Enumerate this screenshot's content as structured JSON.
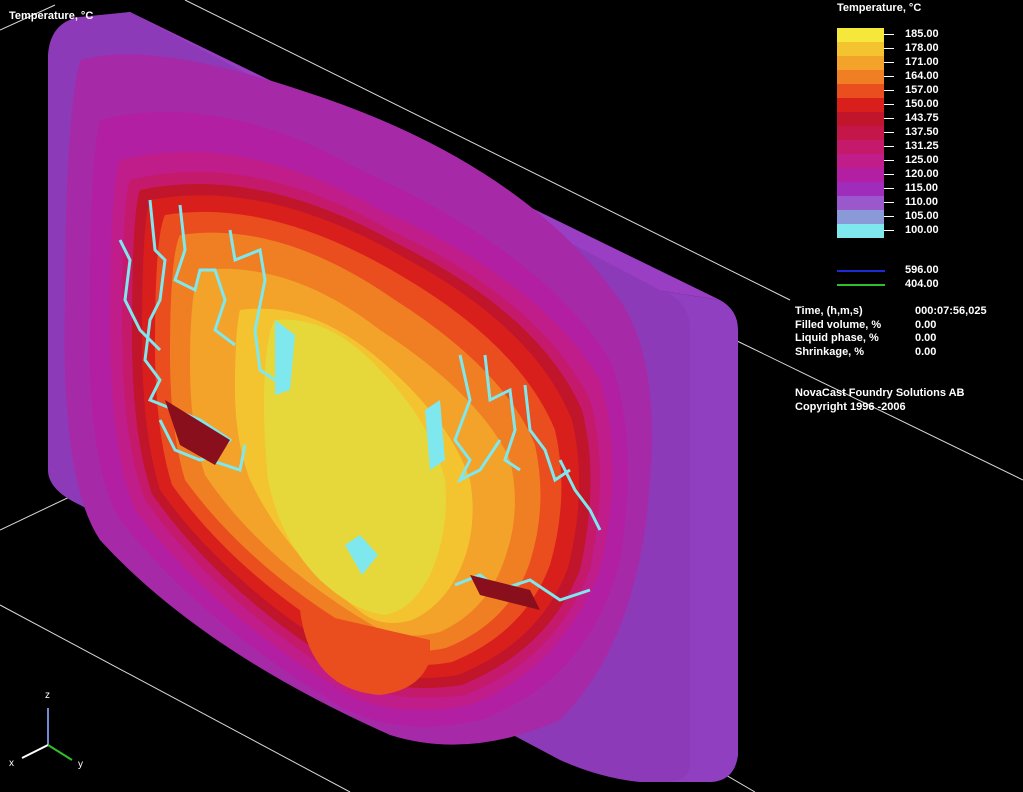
{
  "view": {
    "title": "Temperature, °C"
  },
  "legend": {
    "title": "Temperature, °C",
    "bands": [
      {
        "value": "185.00",
        "color": "#f6e83a"
      },
      {
        "value": "178.00",
        "color": "#f4c430"
      },
      {
        "value": "171.00",
        "color": "#f3a22a"
      },
      {
        "value": "164.00",
        "color": "#f07f24"
      },
      {
        "value": "157.00",
        "color": "#ea4d1e"
      },
      {
        "value": "150.00",
        "color": "#d81f1c"
      },
      {
        "value": "143.75",
        "color": "#c0152a"
      },
      {
        "value": "137.50",
        "color": "#c41648"
      },
      {
        "value": "131.25",
        "color": "#c51a6c"
      },
      {
        "value": "125.00",
        "color": "#c01c8a"
      },
      {
        "value": "120.00",
        "color": "#b21fa2"
      },
      {
        "value": "115.00",
        "color": "#a02cbc"
      },
      {
        "value": "110.00",
        "color": "#9a58cc"
      },
      {
        "value": "105.00",
        "color": "#8a9ad8"
      },
      {
        "value": "100.00",
        "color": "#7ee8ee"
      }
    ],
    "lines": [
      {
        "value": "596.00",
        "color": "#1d2bd6"
      },
      {
        "value": "404.00",
        "color": "#2fbf28"
      }
    ]
  },
  "info": [
    {
      "label": "Time, (h,m,s)",
      "value": "000:07:56,025"
    },
    {
      "label": "Filled volume, %",
      "value": "0.00"
    },
    {
      "label": "Liquid phase, %",
      "value": "0.00"
    },
    {
      "label": "Shrinkage, %",
      "value": "0.00"
    }
  ],
  "credits": {
    "company": "NovaCast Foundry Solutions AB",
    "copyright": "Copyright 1996 -2006"
  },
  "axes": {
    "z": "z",
    "x": "x",
    "y": "y"
  },
  "colors": {
    "plate_edge": "#8a3cb8",
    "plate_face": "#a62aa8",
    "iso_cyan": "#7ee8ee",
    "frame_line": "#ffffff"
  }
}
